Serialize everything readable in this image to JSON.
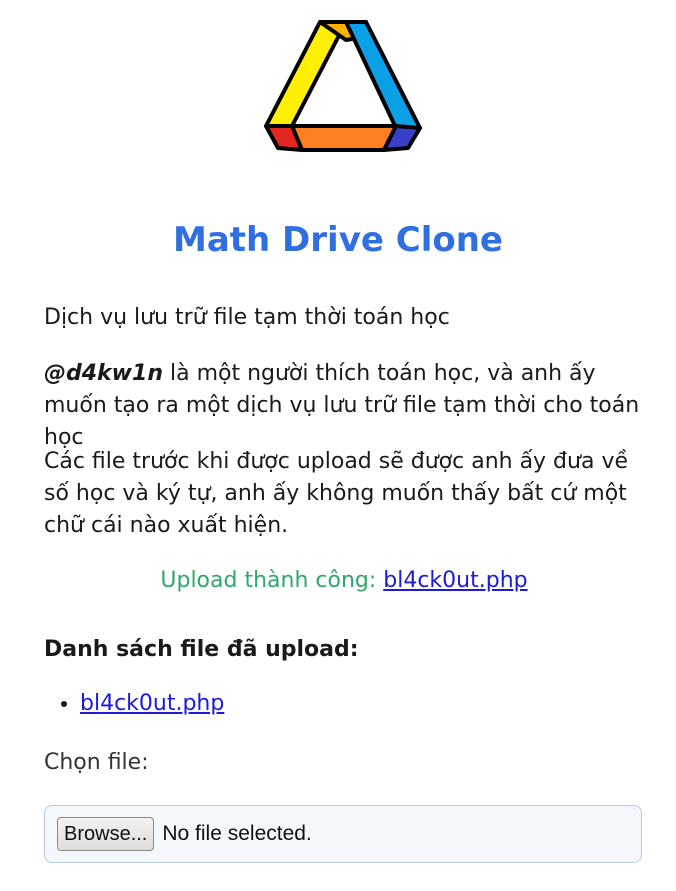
{
  "logo": {
    "icon": "math-drive-triangle-logo"
  },
  "title": "Math Drive Clone",
  "intro": "Dịch vụ lưu trữ file tạm thời toán học",
  "about": {
    "handle": "@d4kw1n",
    "text": " là một người thích toán học, và anh ấy muốn tạo ra một dịch vụ lưu trữ file tạm thời cho toán học"
  },
  "note": "Các file trước khi được upload sẽ được anh ấy đưa về số học và ký tự, anh ấy không muốn thấy bất cứ một chữ cái nào xuất hiện.",
  "status": {
    "prefix": "Upload thành công: ",
    "link": "bl4ck0ut.php",
    "color": "#2ea86b"
  },
  "files": {
    "heading": "Danh sách file đã upload:",
    "items": [
      {
        "name": "bl4ck0ut.php"
      }
    ]
  },
  "upload": {
    "label": "Chọn file:",
    "browse": "Browse...",
    "status": "No file selected."
  },
  "colors": {
    "accent": "#2f6fe0",
    "link": "#1b1bd9"
  }
}
